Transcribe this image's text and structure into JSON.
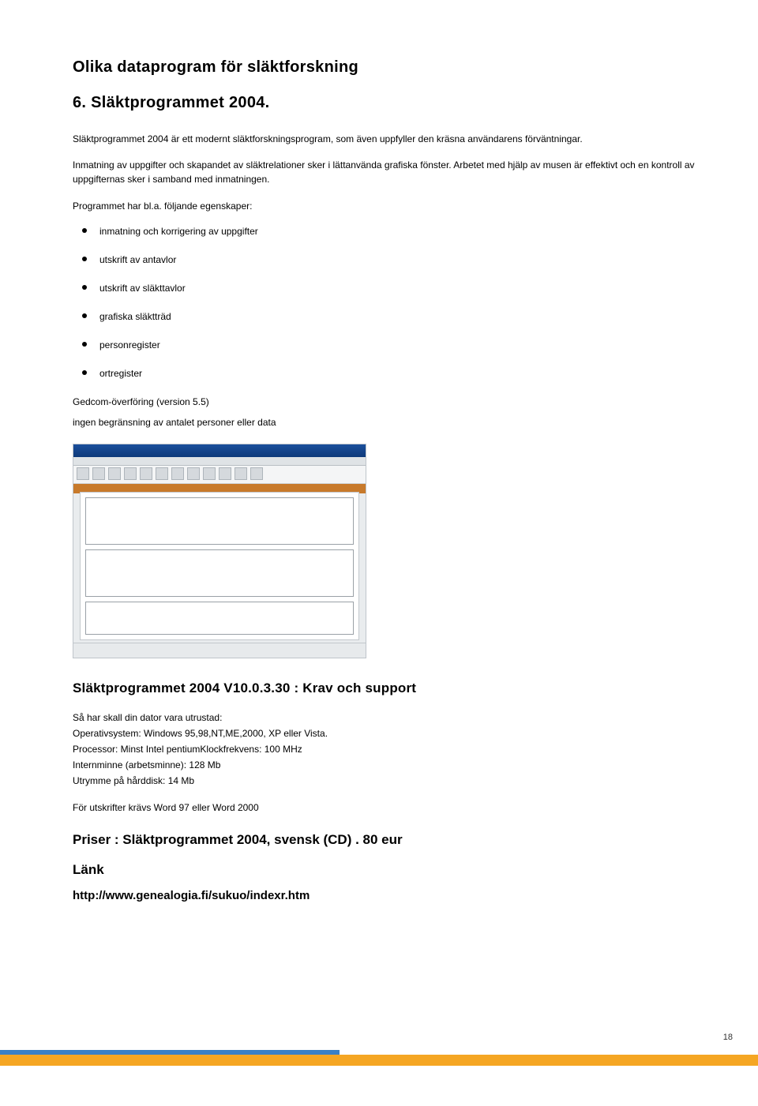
{
  "heading": "Olika dataprogram för släktforskning",
  "section_title": "6. Släktprogrammet 2004.",
  "intro": "Släktprogrammet 2004 är ett modernt släktforskningsprogram, som även uppfyller den kräsna användarens förväntningar.",
  "body": "Inmatning av uppgifter och skapandet av släktrelationer sker i lättanvända grafiska fönster. Arbetet med hjälp av musen är effektivt och en kontroll av uppgifternas sker i samband med inmatningen.",
  "features_lead": "Programmet har bl.a. följande egenskaper:",
  "features": [
    "inmatning och korrigering av uppgifter",
    "utskrift av antavlor",
    "utskrift av släkttavlor",
    "grafiska släktträd",
    "personregister",
    "ortregister"
  ],
  "after_features_1": "Gedcom-överföring (version 5.5)",
  "after_features_2": "ingen begränsning av antalet personer eller data",
  "req_title": "Släktprogrammet 2004 V10.0.3.30  : Krav och support",
  "req": {
    "lead": "Så har skall din dator vara utrustad:",
    "os": "Operativsystem: Windows 95,98,NT,ME,2000, XP eller Vista.",
    "cpu": "Processor: Minst Intel pentiumKlockfrekvens: 100 MHz",
    "ram": "Internminne (arbetsminne): 128 Mb",
    "disk": "Utrymme på hårddisk: 14 Mb",
    "print": "För utskrifter krävs Word 97 eller Word 2000"
  },
  "price": "Priser : Släktprogrammet 2004, svensk (CD) .  80 eur",
  "link_heading": "Länk",
  "link_url": "http://www.genealogia.fi/sukuo/indexr.htm",
  "page_number": "18"
}
